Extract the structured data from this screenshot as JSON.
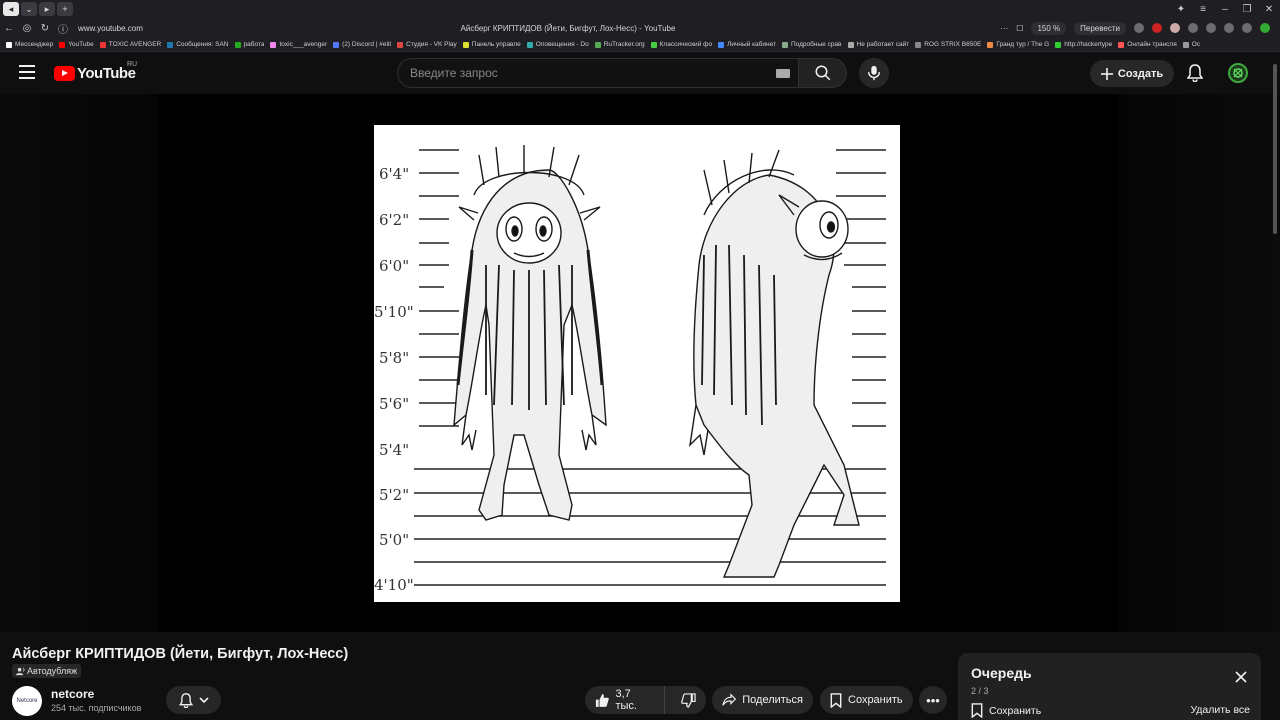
{
  "browser": {
    "url": "www.youtube.com",
    "tab_title": "Айсберг КРИПТИДОВ (Йети, Бигфут, Лох-Несс) - YouTube",
    "zoom": "150 %",
    "translate": "Перевести",
    "bookmarks": [
      "Мессенджер",
      "YouTube",
      "TOXIC AVENGER",
      "Сообщения: SAN",
      "работа",
      "toxic___avenger",
      "(2) Discord | #elit",
      "Студия - VK Play",
      "Панель управле",
      "Оповещения - Do",
      "RuTracker.org",
      "Классический фо",
      "Личный кабинет",
      "Подробные срав",
      "Не работает сайт",
      "ROG STRIX B650E",
      "Гранд тур / The G",
      "http://hackertype",
      "Онлайн трансля",
      "Ос"
    ]
  },
  "header": {
    "logo_text": "YouTube",
    "region": "RU",
    "search_placeholder": "Введите запрос",
    "create_label": "Создать"
  },
  "video": {
    "title": "Айсберг КРИПТИДОВ (Йети, Бигфут, Лох-Несс)",
    "dub_label": "Автодубляж",
    "frame_height_labels": [
      "6'4\"",
      "6'2\"",
      "6'0\"",
      "5'10\"",
      "5'8\"",
      "5'6\"",
      "5'4\"",
      "5'2\"",
      "5'0\"",
      "4'10\""
    ]
  },
  "channel": {
    "avatar_text": "Netcore",
    "name": "netcore",
    "subs": "254 тыс. подписчиков"
  },
  "actions": {
    "likes": "3,7 тыс.",
    "share": "Поделиться",
    "save": "Сохранить"
  },
  "queue": {
    "title": "Очередь",
    "count": "2 / 3",
    "save": "Сохранить",
    "clear": "Удалить все"
  }
}
